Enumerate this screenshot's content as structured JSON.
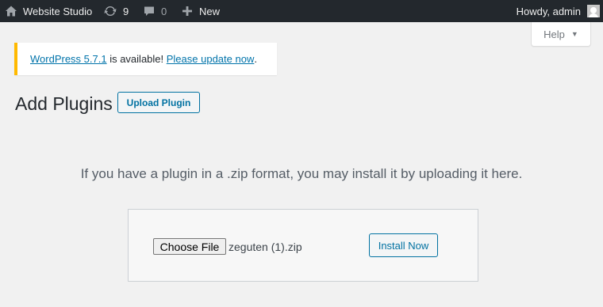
{
  "admin_bar": {
    "site_name": "Website Studio",
    "updates_count": "9",
    "comments_count": "0",
    "new_label": "New",
    "greeting": "Howdy, admin",
    "icons": {
      "site": "home-icon",
      "updates": "refresh-icon",
      "comments": "comment-icon",
      "new": "plus-icon",
      "account": "avatar"
    }
  },
  "help_tab": {
    "label": "Help",
    "caret": "▼"
  },
  "notice": {
    "version_link": "WordPress 5.7.1",
    "middle_text": " is available! ",
    "update_link": "Please update now",
    "end_text": "."
  },
  "page": {
    "title": "Add Plugins",
    "upload_button": "Upload Plugin",
    "upload_help": "If you have a plugin in a .zip format, you may install it by uploading it here."
  },
  "upload_form": {
    "choose_file_label": "Choose File",
    "file_name": "zeguten (1).zip",
    "install_label": "Install Now"
  },
  "colors": {
    "admin_bar_bg": "#23282d",
    "link": "#0073aa",
    "notice_border": "#ffb900",
    "button_primary": "#0071a1"
  }
}
